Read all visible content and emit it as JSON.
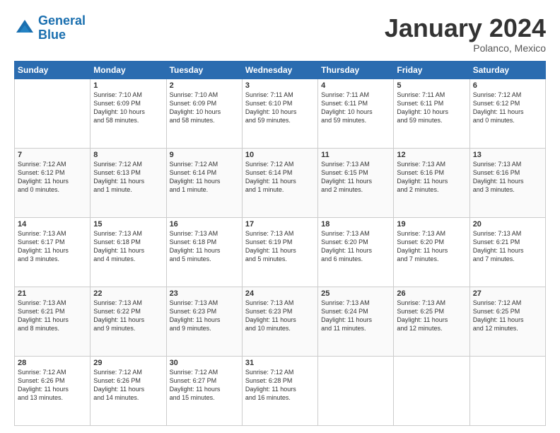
{
  "header": {
    "logo_line1": "General",
    "logo_line2": "Blue",
    "month": "January 2024",
    "location": "Polanco, Mexico"
  },
  "columns": [
    "Sunday",
    "Monday",
    "Tuesday",
    "Wednesday",
    "Thursday",
    "Friday",
    "Saturday"
  ],
  "weeks": [
    [
      {
        "day": "",
        "info": ""
      },
      {
        "day": "1",
        "info": "Sunrise: 7:10 AM\nSunset: 6:09 PM\nDaylight: 10 hours\nand 58 minutes."
      },
      {
        "day": "2",
        "info": "Sunrise: 7:10 AM\nSunset: 6:09 PM\nDaylight: 10 hours\nand 58 minutes."
      },
      {
        "day": "3",
        "info": "Sunrise: 7:11 AM\nSunset: 6:10 PM\nDaylight: 10 hours\nand 59 minutes."
      },
      {
        "day": "4",
        "info": "Sunrise: 7:11 AM\nSunset: 6:11 PM\nDaylight: 10 hours\nand 59 minutes."
      },
      {
        "day": "5",
        "info": "Sunrise: 7:11 AM\nSunset: 6:11 PM\nDaylight: 10 hours\nand 59 minutes."
      },
      {
        "day": "6",
        "info": "Sunrise: 7:12 AM\nSunset: 6:12 PM\nDaylight: 11 hours\nand 0 minutes."
      }
    ],
    [
      {
        "day": "7",
        "info": "Sunrise: 7:12 AM\nSunset: 6:12 PM\nDaylight: 11 hours\nand 0 minutes."
      },
      {
        "day": "8",
        "info": "Sunrise: 7:12 AM\nSunset: 6:13 PM\nDaylight: 11 hours\nand 1 minute."
      },
      {
        "day": "9",
        "info": "Sunrise: 7:12 AM\nSunset: 6:14 PM\nDaylight: 11 hours\nand 1 minute."
      },
      {
        "day": "10",
        "info": "Sunrise: 7:12 AM\nSunset: 6:14 PM\nDaylight: 11 hours\nand 1 minute."
      },
      {
        "day": "11",
        "info": "Sunrise: 7:13 AM\nSunset: 6:15 PM\nDaylight: 11 hours\nand 2 minutes."
      },
      {
        "day": "12",
        "info": "Sunrise: 7:13 AM\nSunset: 6:16 PM\nDaylight: 11 hours\nand 2 minutes."
      },
      {
        "day": "13",
        "info": "Sunrise: 7:13 AM\nSunset: 6:16 PM\nDaylight: 11 hours\nand 3 minutes."
      }
    ],
    [
      {
        "day": "14",
        "info": "Sunrise: 7:13 AM\nSunset: 6:17 PM\nDaylight: 11 hours\nand 3 minutes."
      },
      {
        "day": "15",
        "info": "Sunrise: 7:13 AM\nSunset: 6:18 PM\nDaylight: 11 hours\nand 4 minutes."
      },
      {
        "day": "16",
        "info": "Sunrise: 7:13 AM\nSunset: 6:18 PM\nDaylight: 11 hours\nand 5 minutes."
      },
      {
        "day": "17",
        "info": "Sunrise: 7:13 AM\nSunset: 6:19 PM\nDaylight: 11 hours\nand 5 minutes."
      },
      {
        "day": "18",
        "info": "Sunrise: 7:13 AM\nSunset: 6:20 PM\nDaylight: 11 hours\nand 6 minutes."
      },
      {
        "day": "19",
        "info": "Sunrise: 7:13 AM\nSunset: 6:20 PM\nDaylight: 11 hours\nand 7 minutes."
      },
      {
        "day": "20",
        "info": "Sunrise: 7:13 AM\nSunset: 6:21 PM\nDaylight: 11 hours\nand 7 minutes."
      }
    ],
    [
      {
        "day": "21",
        "info": "Sunrise: 7:13 AM\nSunset: 6:21 PM\nDaylight: 11 hours\nand 8 minutes."
      },
      {
        "day": "22",
        "info": "Sunrise: 7:13 AM\nSunset: 6:22 PM\nDaylight: 11 hours\nand 9 minutes."
      },
      {
        "day": "23",
        "info": "Sunrise: 7:13 AM\nSunset: 6:23 PM\nDaylight: 11 hours\nand 9 minutes."
      },
      {
        "day": "24",
        "info": "Sunrise: 7:13 AM\nSunset: 6:23 PM\nDaylight: 11 hours\nand 10 minutes."
      },
      {
        "day": "25",
        "info": "Sunrise: 7:13 AM\nSunset: 6:24 PM\nDaylight: 11 hours\nand 11 minutes."
      },
      {
        "day": "26",
        "info": "Sunrise: 7:13 AM\nSunset: 6:25 PM\nDaylight: 11 hours\nand 12 minutes."
      },
      {
        "day": "27",
        "info": "Sunrise: 7:12 AM\nSunset: 6:25 PM\nDaylight: 11 hours\nand 12 minutes."
      }
    ],
    [
      {
        "day": "28",
        "info": "Sunrise: 7:12 AM\nSunset: 6:26 PM\nDaylight: 11 hours\nand 13 minutes."
      },
      {
        "day": "29",
        "info": "Sunrise: 7:12 AM\nSunset: 6:26 PM\nDaylight: 11 hours\nand 14 minutes."
      },
      {
        "day": "30",
        "info": "Sunrise: 7:12 AM\nSunset: 6:27 PM\nDaylight: 11 hours\nand 15 minutes."
      },
      {
        "day": "31",
        "info": "Sunrise: 7:12 AM\nSunset: 6:28 PM\nDaylight: 11 hours\nand 16 minutes."
      },
      {
        "day": "",
        "info": ""
      },
      {
        "day": "",
        "info": ""
      },
      {
        "day": "",
        "info": ""
      }
    ]
  ]
}
